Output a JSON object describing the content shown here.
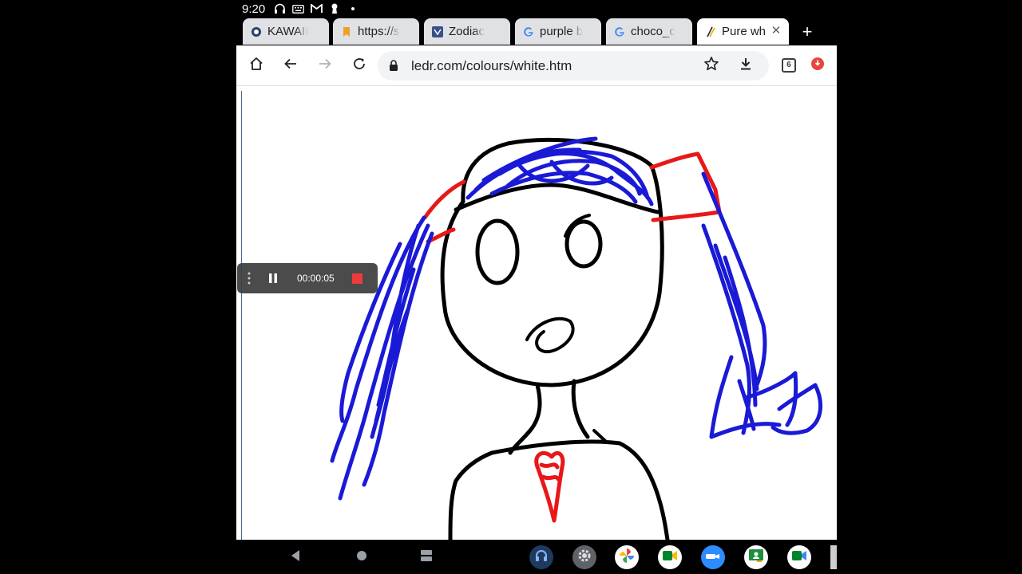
{
  "status_bar": {
    "time": "9:20"
  },
  "tabs": [
    {
      "title": "KAWAII",
      "favicon": "circle-o-icon",
      "active": false
    },
    {
      "title": "https://s",
      "favicon": "bookmark-icon",
      "active": false
    },
    {
      "title": "Zodiac",
      "favicon": "zodiac-icon",
      "active": false
    },
    {
      "title": "purple b",
      "favicon": "google-icon",
      "active": false
    },
    {
      "title": "choco_c",
      "favicon": "google-icon",
      "active": false
    },
    {
      "title": "Pure wh",
      "favicon": "ledr-icon",
      "active": true
    }
  ],
  "new_tab_label": "+",
  "toolbar": {
    "url": "ledr.com/colours/white.htm",
    "tab_count": "6"
  },
  "recorder": {
    "timer": "00:00:05"
  },
  "colors": {
    "stroke_black": "#000000",
    "stroke_blue": "#1a1ad6",
    "stroke_red": "#e81818",
    "record_red": "#ee3b3b",
    "tab_inactive": "#dfe1e5"
  }
}
